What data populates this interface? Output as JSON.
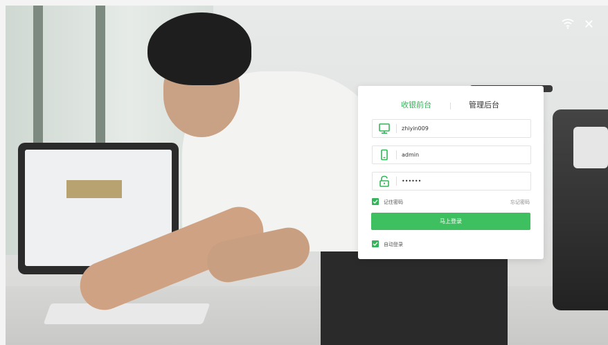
{
  "window": {
    "controls": {
      "wifi_icon": "wifi-icon",
      "close_label": "✕"
    }
  },
  "login": {
    "tabs": [
      {
        "label": "收银前台",
        "active": true
      },
      {
        "label": "管理后台",
        "active": false
      }
    ],
    "fields": {
      "store": {
        "icon": "monitor-icon",
        "value": "zhiyin009"
      },
      "account": {
        "icon": "phone-icon",
        "value": "admin"
      },
      "password": {
        "icon": "unlock-icon",
        "value": "••••••"
      }
    },
    "remember_password": {
      "label": "记住密码",
      "checked": true
    },
    "forgot_password": "忘记密码",
    "submit_label": "马上登录",
    "auto_login": {
      "label": "自动登录",
      "checked": true
    },
    "accent_color": "#35b55a"
  }
}
